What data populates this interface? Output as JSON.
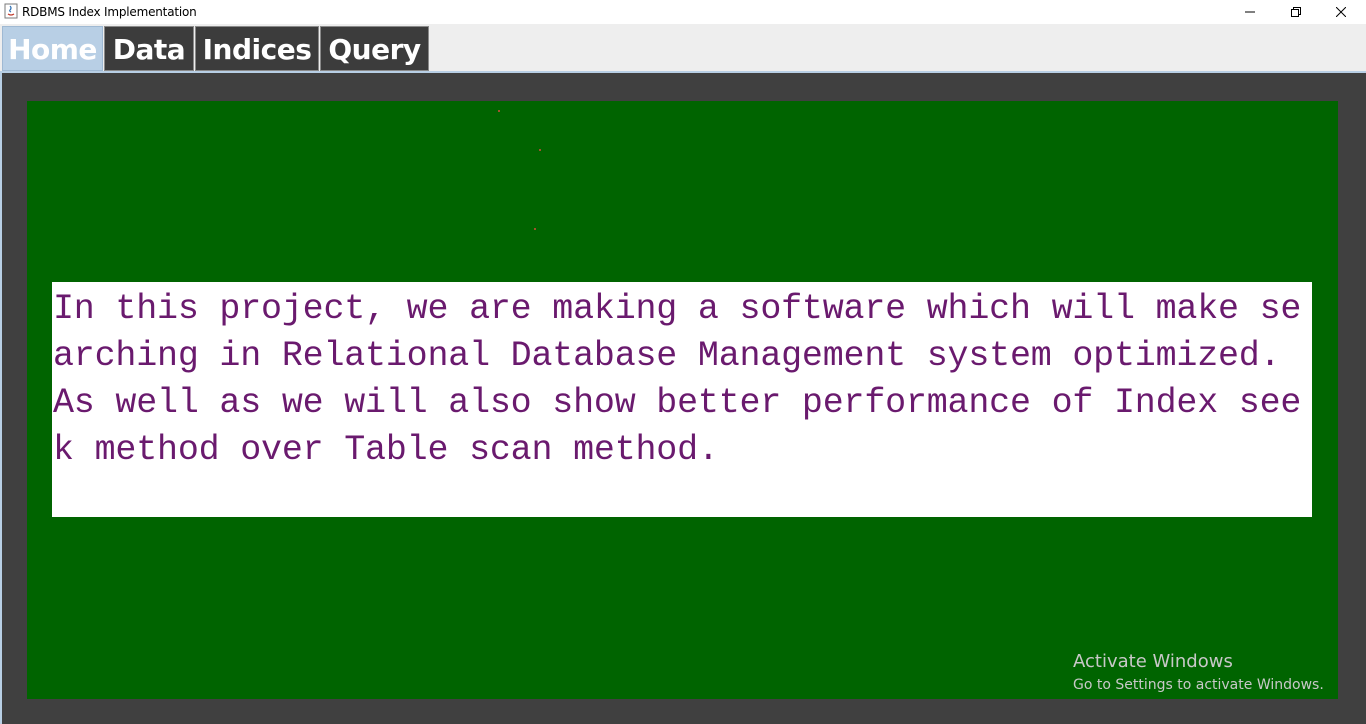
{
  "window": {
    "title": "RDBMS Index Implementation",
    "controls": [
      "minimize-icon",
      "restore-icon",
      "close-icon"
    ]
  },
  "tabs": [
    {
      "label": "Home",
      "selected": true
    },
    {
      "label": "Data",
      "selected": false
    },
    {
      "label": "Indices",
      "selected": false
    },
    {
      "label": "Query",
      "selected": false
    }
  ],
  "home": {
    "description_lines": [
      "In this project, we are making a software which will make se",
      "arching in Relational Database Management system optimized.",
      "As well as we will also show better performance of Index see",
      "k method over Table scan method."
    ]
  },
  "watermark": {
    "line1": "Activate Windows",
    "line2": "Go to Settings to activate Windows."
  },
  "colors": {
    "selected_tab": "#b8cfe5",
    "tab_background": "#3c3c3c",
    "panel_green": "#006400",
    "frame_dark": "#404040",
    "text_purple": "#6a1a6e"
  }
}
